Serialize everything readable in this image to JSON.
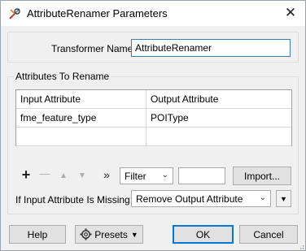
{
  "window": {
    "title": "AttributeRenamer Parameters",
    "close_glyph": "✕",
    "icon": "fme-transformer-icon"
  },
  "transformer": {
    "name_label": "Transformer Name:",
    "name_value": "AttributeRenamer"
  },
  "attributes_group": {
    "title": "Attributes To Rename",
    "columns": [
      "Input Attribute",
      "Output Attribute"
    ],
    "rows": [
      [
        "fme_feature_type",
        "POIType"
      ],
      [
        "",
        ""
      ]
    ]
  },
  "toolbar": {
    "add_glyph": "+",
    "remove_glyph": "—",
    "move_up_glyph": "▲",
    "move_down_glyph": "▼",
    "more_glyph": "»",
    "filter_value": "Filter",
    "filter_text": "",
    "import_label": "Import..."
  },
  "missing": {
    "label": "If Input Attribute Is Missing:",
    "value": "Remove Output Attribute",
    "menu_glyph": "▼"
  },
  "buttons": {
    "help": "Help",
    "presets": "Presets",
    "ok": "OK",
    "cancel": "Cancel"
  },
  "colors": {
    "accent": "#0078d7",
    "input_focus_border": "#3c7fb1",
    "window_bg": "#f0f0f0"
  }
}
